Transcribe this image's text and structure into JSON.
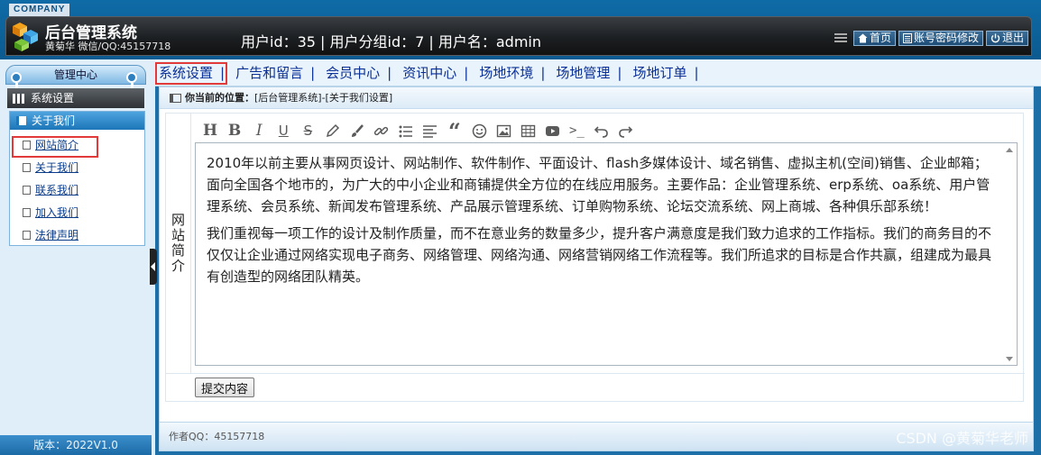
{
  "header": {
    "company_badge": "COMPANY",
    "title": "后台管理系统",
    "subtitle": "黄菊华 微信/QQ:45157718",
    "user_info": "用户id：35 | 用户分组id：7 | 用户名：admin",
    "buttons": [
      {
        "label": "首页",
        "icon": "home-icon"
      },
      {
        "label": "账号密码修改",
        "icon": "list-icon"
      },
      {
        "label": "退出",
        "icon": "power-icon"
      }
    ]
  },
  "sidebar": {
    "heading": "管理中心",
    "section": "系统设置",
    "group_title": "关于我们",
    "items": [
      {
        "label": "网站简介",
        "active": true
      },
      {
        "label": "关于我们"
      },
      {
        "label": "联系我们"
      },
      {
        "label": "加入我们"
      },
      {
        "label": "法律声明"
      }
    ],
    "version": "版本：2022V1.0"
  },
  "topmenu": {
    "items": [
      {
        "label": "系统设置",
        "active": true
      },
      {
        "label": "广告和留言"
      },
      {
        "label": "会员中心"
      },
      {
        "label": "资讯中心"
      },
      {
        "label": "场地环境"
      },
      {
        "label": "场地管理"
      },
      {
        "label": "场地订单"
      }
    ],
    "separator": "|"
  },
  "breadcrumb": {
    "prefix": "你当前的位置：",
    "path": "[后台管理系统]-[关于我们设置]"
  },
  "form": {
    "field_label": "网站简介",
    "toolbar": [
      "H",
      "B",
      "I",
      "U",
      "S",
      "pencil",
      "brush",
      "link",
      "list-ul",
      "align",
      "quote",
      "smile",
      "image",
      "table",
      "video",
      "code",
      "undo",
      "redo"
    ],
    "content": [
      "2010年以前主要从事网页设计、网站制作、软件制作、平面设计、flash多媒体设计、域名销售、虚拟主机(空间)销售、企业邮箱；面向全国各个地市的，为广大的中小企业和商铺提供全方位的在线应用服务。主要作品：企业管理系统、erp系统、oa系统、用户管理系统、会员系统、新闻发布管理系统、产品展示管理系统、订单购物系统、论坛交流系统、网上商城、各种俱乐部系统！",
      "我们重视每一项工作的设计及制作质量，而不在意业务的数量多少，提升客户满意度是我们致力追求的工作指标。我们的商务目的不仅仅让企业通过网络实现电子商务、网络管理、网络沟通、网络营销网络工作流程等。我们所追求的目标是合作共赢，组建成为最具有创造型的网络团队精英。"
    ],
    "submit_label": "提交内容"
  },
  "footer": {
    "author": "作者QQ：45157718"
  },
  "watermark": "CSDN @黄菊华老师",
  "colors": {
    "highlight_border": "#e23a3a",
    "menu_text": "#0a2f96",
    "header_bg": "#0b5a90"
  }
}
